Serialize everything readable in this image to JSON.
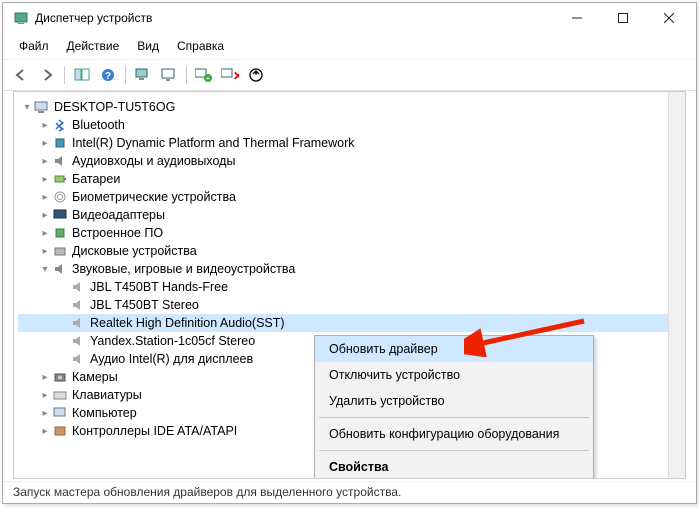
{
  "title": "Диспетчер устройств",
  "menu": {
    "file": "Файл",
    "action": "Действие",
    "view": "Вид",
    "help": "Справка"
  },
  "root": "DESKTOP-TU5T6OG",
  "cats": {
    "bluetooth": "Bluetooth",
    "intel": "Intel(R) Dynamic Platform and Thermal Framework",
    "audioio": "Аудиовходы и аудиовыходы",
    "battery": "Батареи",
    "biometric": "Биометрические устройства",
    "video": "Видеоадаптеры",
    "firmware": "Встроенное ПО",
    "disk": "Дисковые устройства",
    "sound": "Звуковые, игровые и видеоустройства",
    "camera": "Камеры",
    "keyboard": "Клавиатуры",
    "computer": "Компьютер",
    "ide": "Контроллеры IDE ATA/ATAPI"
  },
  "sound_children": {
    "jbl_hf": "JBL T450BT Hands-Free",
    "jbl_st": "JBL T450BT Stereo",
    "realtek": "Realtek High Definition Audio(SST)",
    "yandex": "Yandex.Station-1c05cf Stereo",
    "inteldisp": "Аудио Intel(R) для дисплеев"
  },
  "ctx": {
    "update": "Обновить драйвер",
    "disable": "Отключить устройство",
    "uninstall": "Удалить устройство",
    "scan": "Обновить конфигурацию оборудования",
    "props": "Свойства"
  },
  "status": "Запуск мастера обновления драйверов для выделенного устройства."
}
